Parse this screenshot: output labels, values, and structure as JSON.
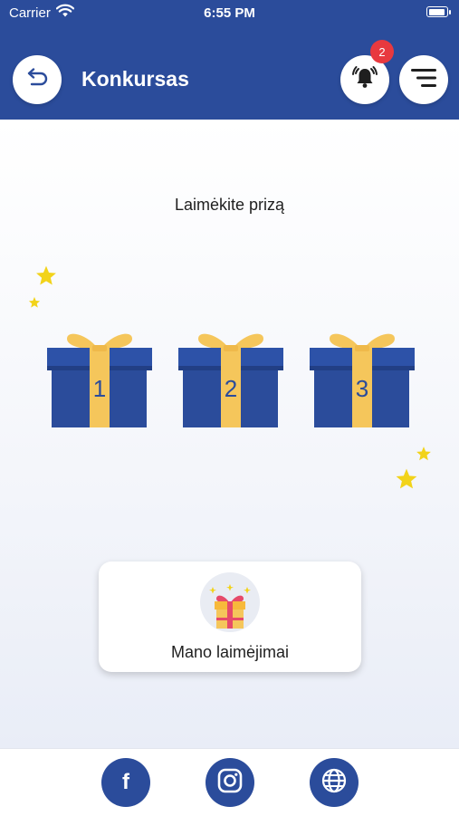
{
  "status_bar": {
    "carrier": "Carrier",
    "time": "6:55 PM",
    "icons": [
      "wifi-icon",
      "battery-icon"
    ]
  },
  "header": {
    "title": "Konkursas",
    "notification_count": "2",
    "icons": [
      "back-arrow-icon",
      "bell-icon",
      "menu-icon"
    ]
  },
  "main": {
    "heading": "Laimėkite prizą",
    "gifts": [
      {
        "label": "1"
      },
      {
        "label": "2"
      },
      {
        "label": "3"
      }
    ],
    "wins_card": {
      "label": "Mano laimėjimai",
      "icon": "gift-icon"
    }
  },
  "footer": {
    "links": [
      {
        "icon": "facebook-icon",
        "glyph": "f"
      },
      {
        "icon": "instagram-icon"
      },
      {
        "icon": "globe-icon"
      }
    ]
  },
  "colors": {
    "primary": "#2b4c9b",
    "gift_ribbon": "#f5c65b",
    "star": "#f2d31a",
    "badge": "#e8393f"
  }
}
